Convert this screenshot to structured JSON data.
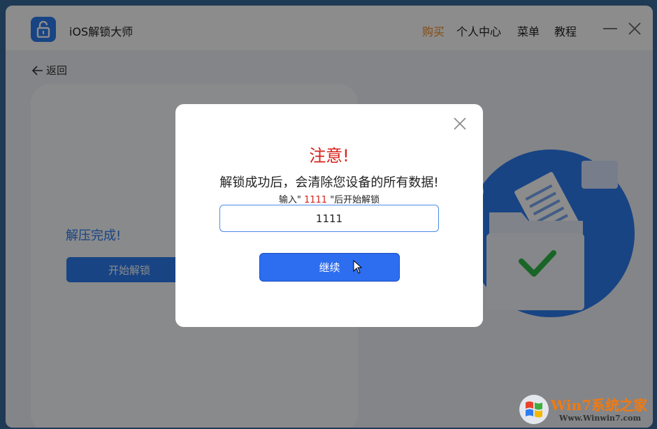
{
  "app": {
    "title": "iOS解锁大师"
  },
  "nav": {
    "buy": "购买",
    "personal_center": "个人中心",
    "menu": "菜单",
    "tutorial": "教程"
  },
  "content": {
    "back": "返回",
    "status": "解压完成!",
    "start_button": "开始解锁"
  },
  "dialog": {
    "title": "注意!",
    "message": "解锁成功后，会清除您设备的所有数据!",
    "hint_prefix": "输入\"",
    "hint_code": "1111",
    "hint_suffix": "\"后开始解锁",
    "input_value": "1111",
    "continue_button": "继续"
  },
  "watermark": {
    "text": "Win7系统之家",
    "url": "Www.Winwin7.com"
  },
  "colors": {
    "accent": "#2d7cf0",
    "buy": "#f08a24",
    "warning": "#d9221a"
  },
  "icons": [
    "lock-icon",
    "minimize-icon",
    "close-icon",
    "back-arrow-icon",
    "folder-check-illustration",
    "dialog-close-icon",
    "mouse-cursor-icon",
    "windows-logo-icon"
  ]
}
